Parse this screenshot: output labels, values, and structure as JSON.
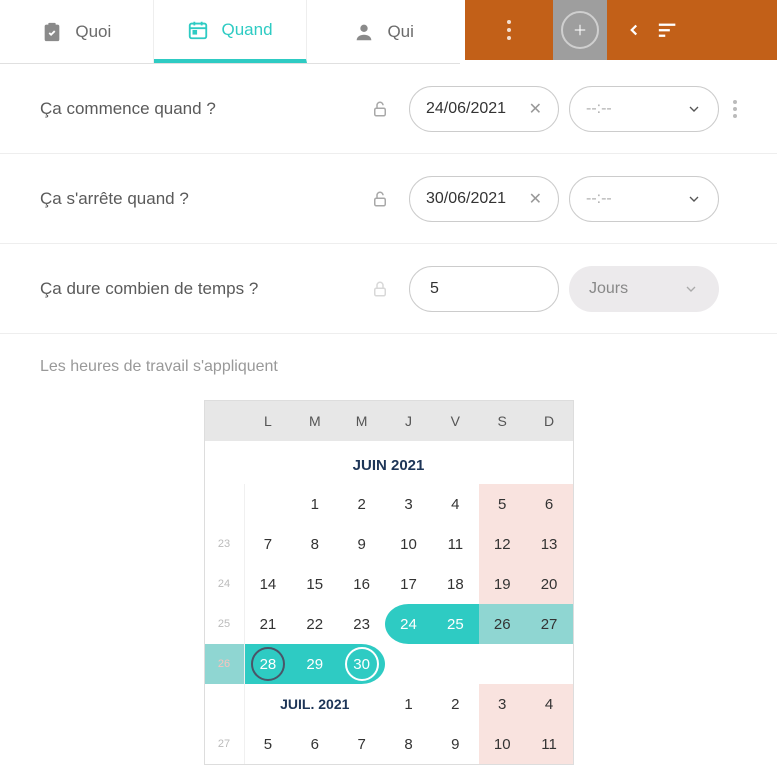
{
  "tabs": {
    "quoi": "Quoi",
    "quand": "Quand",
    "qui": "Qui"
  },
  "rows": {
    "start_label": "Ça commence quand ?",
    "start_date": "24/06/2021",
    "start_time_placeholder": "--:--",
    "end_label": "Ça s'arrête quand ?",
    "end_date": "30/06/2021",
    "end_time_placeholder": "--:--",
    "duration_label": "Ça dure combien de temps ?",
    "duration_value": "5",
    "duration_unit": "Jours"
  },
  "note": "Les heures de travail s'appliquent",
  "calendar": {
    "weekdays": [
      "L",
      "M",
      "M",
      "J",
      "V",
      "S",
      "D"
    ],
    "month1": "JUIN 2021",
    "month2": "JUIL. 2021",
    "rows": [
      {
        "week": "",
        "days": [
          "",
          "",
          "1",
          "2",
          "3",
          "4",
          "5",
          "6"
        ],
        "weekend_idx": [
          6,
          7
        ]
      },
      {
        "week": "23",
        "days": [
          "",
          "7",
          "8",
          "9",
          "10",
          "11",
          "12",
          "13"
        ],
        "weekend_idx": [
          6,
          7
        ]
      },
      {
        "week": "24",
        "days": [
          "",
          "14",
          "15",
          "16",
          "17",
          "18",
          "19",
          "20"
        ],
        "weekend_idx": [
          6,
          7
        ]
      },
      {
        "week": "25",
        "days": [
          "",
          "21",
          "22",
          "23",
          "24",
          "25",
          "26",
          "27"
        ]
      },
      {
        "week": "26",
        "days": [
          "",
          "28",
          "29",
          "30"
        ]
      }
    ],
    "july_row1": {
      "week": "",
      "days": [
        "",
        "",
        "",
        "",
        "1",
        "2",
        "3",
        "4"
      ],
      "weekend_idx": [
        6,
        7
      ]
    },
    "july_row2": {
      "week": "27",
      "days": [
        "",
        "5",
        "6",
        "7",
        "8",
        "9",
        "10",
        "11"
      ],
      "weekend_idx": [
        6,
        7
      ]
    }
  }
}
